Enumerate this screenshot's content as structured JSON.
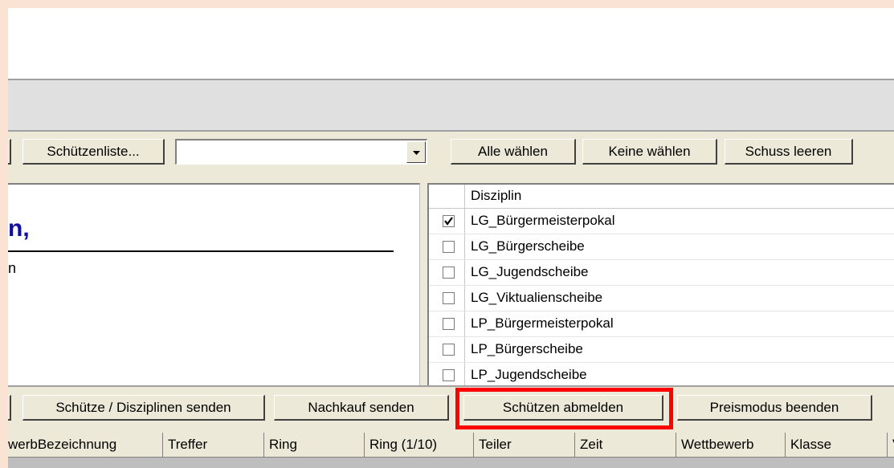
{
  "toolbar": {
    "schuetzenliste_label": "Schützenliste...",
    "combo_value": "",
    "alle_waehlen_label": "Alle wählen",
    "keine_waehlen_label": "Keine wählen",
    "schuss_leeren_label": "Schuss leeren"
  },
  "left_panel": {
    "greeting": "n,",
    "subtext": "n"
  },
  "grid": {
    "header": "Disziplin",
    "rows": [
      {
        "label": "LG_Bürgermeisterpokal",
        "checked": true
      },
      {
        "label": "LG_Bürgerscheibe",
        "checked": false
      },
      {
        "label": "LG_Jugendscheibe",
        "checked": false
      },
      {
        "label": "LG_Viktualienscheibe",
        "checked": false
      },
      {
        "label": "LP_Bürgermeisterpokal",
        "checked": false
      },
      {
        "label": "LP_Bürgerscheibe",
        "checked": false
      },
      {
        "label": "LP_Jugendscheibe",
        "checked": false
      }
    ]
  },
  "actions": {
    "send_label": "Schütze / Disziplinen senden",
    "nachkauf_label": "Nachkauf senden",
    "abmelden_label": "Schützen abmelden",
    "preismodus_label": "Preismodus beenden"
  },
  "list": {
    "columns": [
      "werbBezeichnung",
      "Treffer",
      "Ring",
      "Ring (1/10)",
      "Teiler",
      "Zeit",
      "Wettbewerb",
      "Klasse",
      "V"
    ]
  },
  "colors": {
    "highlight": "#ff0000",
    "greeting": "#1010a0"
  }
}
